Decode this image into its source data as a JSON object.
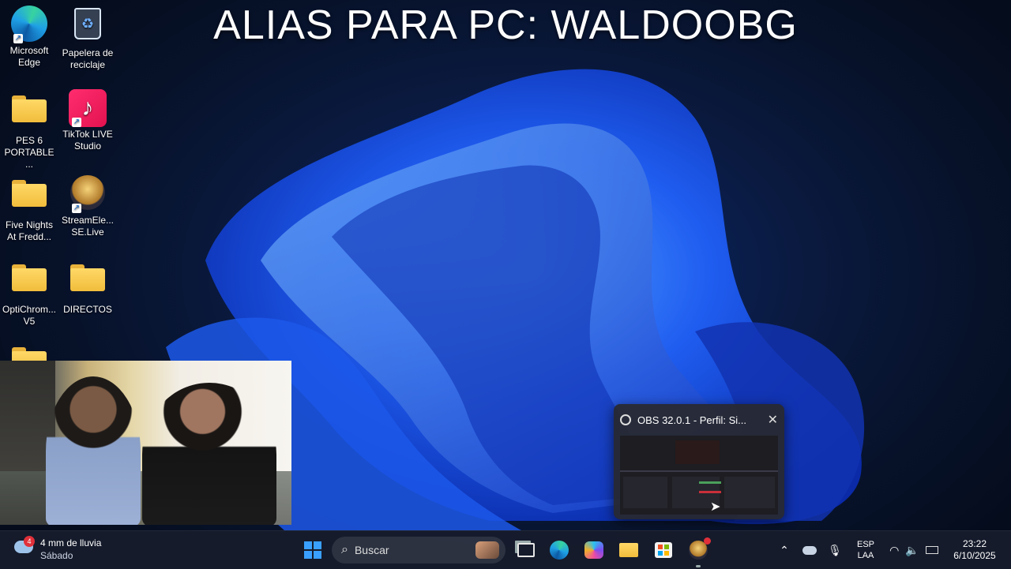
{
  "overlay": {
    "title": "ALIAS PARA PC: WALDOOBG"
  },
  "desktop": {
    "icons": [
      {
        "label": "Microsoft Edge"
      },
      {
        "label": "Papelera de reciclaje"
      },
      {
        "label": "PES 6 PORTABLE ..."
      },
      {
        "label": "TikTok LIVE Studio"
      },
      {
        "label": "Five Nights At Fredd..."
      },
      {
        "label": "StreamEle... SE.Live"
      },
      {
        "label": "OptiChrom... V5"
      },
      {
        "label": "DIRECTOS"
      }
    ]
  },
  "obs_preview": {
    "title": "OBS 32.0.1 - Perfil: Si..."
  },
  "taskbar": {
    "weather": {
      "badge": "4",
      "text": "4 mm de lluvia",
      "day": "Sábado"
    },
    "search_placeholder": "Buscar",
    "language": {
      "top": "ESP",
      "bottom": "LAA"
    },
    "clock": {
      "time": "23:22",
      "date": "6/10/2025"
    }
  },
  "colors": {
    "accent": "#1f6fff",
    "taskbar": "#161c2c",
    "notification": "#e0303a"
  }
}
